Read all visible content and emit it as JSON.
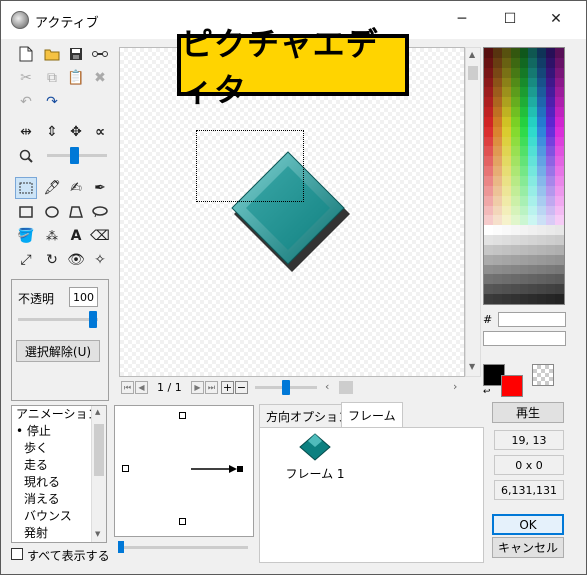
{
  "window": {
    "title": "アクティブ",
    "minimize": "─",
    "maximize": "☐",
    "close": "✕"
  },
  "overlay_title": "ピクチャエディタ",
  "tools": {
    "row1": [
      "new-file-icon",
      "open-folder-icon",
      "save-icon",
      "link-icon"
    ],
    "row2": [
      "cut-icon",
      "copy-icon",
      "paste-icon",
      "delete-icon"
    ],
    "row3": [
      "undo-icon",
      "redo-icon"
    ],
    "row4": [
      "flip-horizontal-icon",
      "flip-vertical-icon",
      "rotate-icon",
      "alpha-icon"
    ],
    "row5": [
      "select-rect-icon",
      "eyedropper-icon",
      "brush-icon",
      "pen-icon"
    ],
    "row6": [
      "rectangle-icon",
      "ellipse-icon",
      "polygon-icon",
      "lasso-icon"
    ],
    "row7": [
      "fill-bucket-icon",
      "spray-icon",
      "text-icon",
      "eraser-icon"
    ],
    "row8": [
      "line-icon",
      "rotate-circle-icon",
      "eye-icon",
      "sparkle-icon"
    ]
  },
  "zoom_level": 0.45,
  "opacity": {
    "label": "不透明",
    "value": "100",
    "slider_fraction": 0.98
  },
  "deselect_label": "選択解除(U)",
  "frame_nav": {
    "counter": "1 / 1",
    "zoom_slider_fraction": 0.5
  },
  "animation": {
    "items": [
      "アニメーション",
      "停止",
      "歩く",
      "走る",
      "現れる",
      "消える",
      "バウンス",
      "発射"
    ],
    "selected": "停止",
    "show_all_label": "すべて表示する",
    "show_all_checked": true
  },
  "tabs": [
    {
      "label": "方向オプション"
    },
    {
      "label": "フレーム"
    }
  ],
  "active_tab": "フレーム",
  "frames": [
    {
      "label": "フレーム 1"
    }
  ],
  "colors": {
    "foreground": "#000000",
    "background": "#ff0000",
    "accent": "#007a7a",
    "hash": "#"
  },
  "regenerate_label": "再生",
  "info": {
    "coords": "19, 13",
    "size": "0 x 0",
    "rgb": "6,131,131"
  },
  "ok_label": "OK",
  "cancel_label": "キャンセル"
}
